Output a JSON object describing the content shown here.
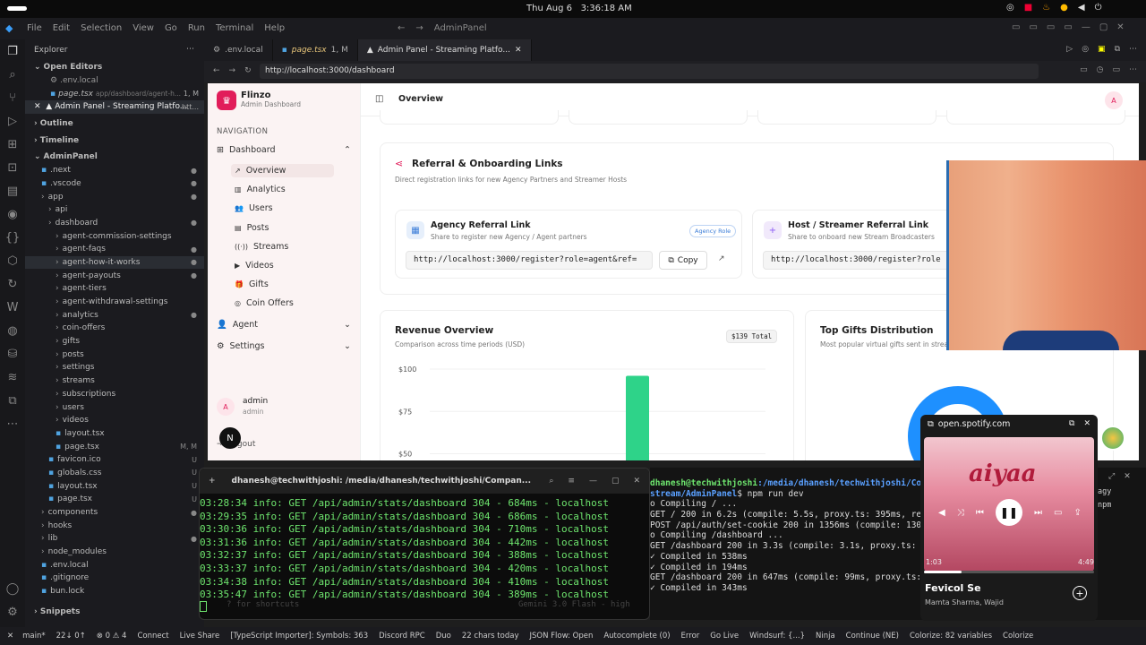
{
  "topbar": {
    "datetime": "Thu Aug 6   3:36:18 AM"
  },
  "menu": {
    "items": [
      "File",
      "Edit",
      "Selection",
      "View",
      "Go",
      "Run",
      "Terminal",
      "Help"
    ],
    "search": "AdminPanel"
  },
  "explorer": {
    "title": "Explorer",
    "open_editors": "Open Editors",
    "oe": [
      {
        "name": ".env.local",
        "mod": ""
      },
      {
        "name": "page.tsx",
        "path": "app/dashboard/agent-h...",
        "mod": "1, M"
      },
      {
        "name": "Admin Panel - Streaming Platfo...",
        "path": "htt..."
      }
    ],
    "outline": "Outline",
    "timeline": "Timeline",
    "project": "AdminPanel",
    "tree": [
      {
        "n": ".next",
        "i": 1,
        "d": "●"
      },
      {
        "n": ".vscode",
        "i": 1,
        "d": "●"
      },
      {
        "n": "app",
        "i": 1,
        "d": "●"
      },
      {
        "n": "api",
        "i": 2,
        "d": ""
      },
      {
        "n": "dashboard",
        "i": 2,
        "d": "●"
      },
      {
        "n": "agent-commission-settings",
        "i": 3,
        "d": ""
      },
      {
        "n": "agent-faqs",
        "i": 3,
        "d": "●"
      },
      {
        "n": "agent-how-it-works",
        "i": 3,
        "d": "●"
      },
      {
        "n": "agent-payouts",
        "i": 3,
        "d": "●"
      },
      {
        "n": "agent-tiers",
        "i": 3,
        "d": ""
      },
      {
        "n": "agent-withdrawal-settings",
        "i": 3,
        "d": ""
      },
      {
        "n": "analytics",
        "i": 3,
        "d": "●"
      },
      {
        "n": "coin-offers",
        "i": 3,
        "d": ""
      },
      {
        "n": "gifts",
        "i": 3,
        "d": ""
      },
      {
        "n": "posts",
        "i": 3,
        "d": ""
      },
      {
        "n": "settings",
        "i": 3,
        "d": ""
      },
      {
        "n": "streams",
        "i": 3,
        "d": ""
      },
      {
        "n": "subscriptions",
        "i": 3,
        "d": ""
      },
      {
        "n": "users",
        "i": 3,
        "d": ""
      },
      {
        "n": "videos",
        "i": 3,
        "d": ""
      },
      {
        "n": "layout.tsx",
        "i": 3,
        "d": ""
      },
      {
        "n": "page.tsx",
        "i": 3,
        "d": "M, M"
      },
      {
        "n": "favicon.ico",
        "i": 2,
        "d": "U"
      },
      {
        "n": "globals.css",
        "i": 2,
        "d": "U"
      },
      {
        "n": "layout.tsx",
        "i": 2,
        "d": "U"
      },
      {
        "n": "page.tsx",
        "i": 2,
        "d": "U"
      },
      {
        "n": "components",
        "i": 1,
        "d": "●"
      },
      {
        "n": "hooks",
        "i": 1,
        "d": ""
      },
      {
        "n": "lib",
        "i": 1,
        "d": "●"
      },
      {
        "n": "node_modules",
        "i": 1,
        "d": ""
      },
      {
        "n": ".env.local",
        "i": 1,
        "d": ""
      },
      {
        "n": ".gitignore",
        "i": 1,
        "d": ""
      },
      {
        "n": "bun.lock",
        "i": 1,
        "d": ""
      }
    ],
    "snippets": "Snippets"
  },
  "tabs": [
    {
      "label": ".env.local"
    },
    {
      "label": "page.tsx",
      "extra": "1, M"
    },
    {
      "label": "Admin Panel - Streaming Platfo..."
    }
  ],
  "url": "http://localhost:3000/dashboard",
  "app": {
    "brand": "Flinzo",
    "brand_sub": "Admin Dashboard",
    "nav_heading": "NAVIGATION",
    "dashboard": "Dashboard",
    "nav": [
      "Overview",
      "Analytics",
      "Users",
      "Posts",
      "Streams",
      "Videos",
      "Gifts",
      "Coin Offers"
    ],
    "agent": "Agent",
    "settings": "Settings",
    "user": "admin",
    "user_role": "admin",
    "logout": "Logout",
    "avatar": "A",
    "header_title": "Overview",
    "referral": {
      "title": "Referral & Onboarding Links",
      "sub": "Direct registration links for new Agency Partners and Streamer Hosts",
      "agency_title": "Agency Referral Link",
      "agency_sub": "Share to register new Agency / Agent partners",
      "agency_badge": "Agency Role",
      "agency_url": "http://localhost:3000/register?role=agent&ref=",
      "copy": "Copy",
      "host_title": "Host / Streamer Referral Link",
      "host_sub": "Share to onboard new Stream Broadcasters",
      "host_url": "http://localhost:3000/register?role"
    },
    "revenue": {
      "title": "Revenue Overview",
      "sub": "Comparison across time periods (USD)",
      "total": "$139 Total"
    },
    "gifts": {
      "title": "Top Gifts Distribution",
      "sub": "Most popular virtual gifts sent in stream"
    }
  },
  "chart_data": {
    "type": "bar",
    "yticks": [
      "$100",
      "$75",
      "$50"
    ],
    "values": [
      96
    ],
    "ylim": [
      50,
      100
    ],
    "color": "#2ed389"
  },
  "terminal": {
    "title": "dhanesh@techwithjoshi: /media/dhanesh/techwithjoshi/Compan...",
    "lines": [
      "03:28:34 info: GET /api/admin/stats/dashboard 304 - 684ms - localhost",
      "03:29:35 info: GET /api/admin/stats/dashboard 304 - 686ms - localhost",
      "03:30:36 info: GET /api/admin/stats/dashboard 304 - 710ms - localhost",
      "03:31:36 info: GET /api/admin/stats/dashboard 304 - 442ms - localhost",
      "03:32:37 info: GET /api/admin/stats/dashboard 304 - 388ms - localhost",
      "03:33:37 info: GET /api/admin/stats/dashboard 304 - 420ms - localhost",
      "03:34:38 info: GET /api/admin/stats/dashboard 304 - 410ms - localhost",
      "03:35:47 info: GET /api/admin/stats/dashboard 304 - 389ms - localhost"
    ],
    "hint": "? for shortcuts",
    "model": "Gemini 3.0 Flash - high"
  },
  "rterm": {
    "prompt_user": "dhanesh@techwithjoshi",
    "prompt_path": ":/media/dhanesh/techwithjoshi/Compan",
    "path2": "stream/AdminPanel",
    "cmd": "$ npm run dev",
    "lines": [
      "o Compiling / ...",
      "  GET / 200 in 6.2s (compile: 5.5s, proxy.ts: 395ms, rende",
      "  POST /api/auth/set-cookie 200 in 1356ms (compile: 1304ms",
      "o Compiling /dashboard ...",
      "  GET /dashboard 200 in 3.3s (compile: 3.1s, proxy.ts: 29m",
      "✓ Compiled in 538ms",
      "✓ Compiled in 194ms",
      "  GET /dashboard 200 in 647ms (compile: 99ms, proxy.ts: 12",
      "✓ Compiled in 343ms"
    ],
    "side1": "agy",
    "side2": "npm"
  },
  "spotify": {
    "site": "open.spotify.com",
    "album_text": "aiyaa",
    "elapsed": "1:03",
    "duration": "4:49",
    "progress": 0.22,
    "track": "Fevicol Se",
    "artist": "Mamta Sharma, Wajid"
  },
  "status": {
    "items": [
      "main*",
      "22↓ 0↑",
      "⊗ 0 ⚠ 4",
      "Connect",
      "Live Share",
      "[TypeScript Importer]: Symbols: 363",
      "Discord RPC",
      "Duo",
      "22 chars today",
      "JSON Flow: Open",
      "Autocomplete (0)",
      "Error",
      "Go Live",
      "Windsurf: {...}",
      "Ninja",
      "Continue (NE)",
      "Colorize: 82 variables",
      "Colorize"
    ]
  }
}
